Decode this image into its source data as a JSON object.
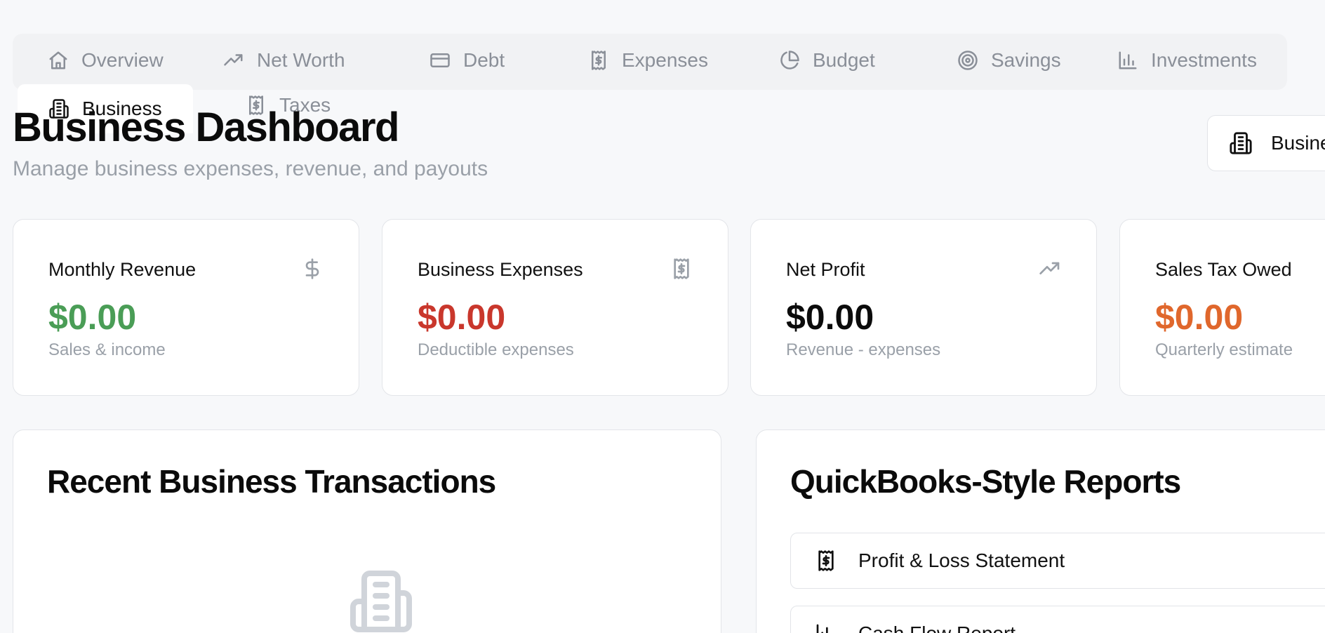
{
  "tabs": [
    {
      "label": "Overview",
      "icon": "home-icon"
    },
    {
      "label": "Net Worth",
      "icon": "trending-up-icon"
    },
    {
      "label": "Debt",
      "icon": "credit-card-icon"
    },
    {
      "label": "Expenses",
      "icon": "receipt-icon"
    },
    {
      "label": "Budget",
      "icon": "pie-chart-icon"
    },
    {
      "label": "Savings",
      "icon": "target-icon"
    },
    {
      "label": "Investments",
      "icon": "bar-chart-icon"
    },
    {
      "label": "Business",
      "icon": "building-icon",
      "active": true
    },
    {
      "label": "Taxes",
      "icon": "receipt-icon"
    }
  ],
  "header": {
    "title": "Business Dashboard",
    "subtitle": "Manage business expenses, revenue, and payouts",
    "action_label": "Business"
  },
  "stats": [
    {
      "label": "Monthly Revenue",
      "value": "$0.00",
      "sub": "Sales & income",
      "icon": "dollar-icon",
      "color": "#4a9d56"
    },
    {
      "label": "Business Expenses",
      "value": "$0.00",
      "sub": "Deductible expenses",
      "icon": "receipt-icon",
      "color": "#c9372c"
    },
    {
      "label": "Net Profit",
      "value": "$0.00",
      "sub": "Revenue - expenses",
      "icon": "trending-up-icon",
      "color": "#0b0b0b"
    },
    {
      "label": "Sales Tax Owed",
      "value": "$0.00",
      "sub": "Quarterly estimate",
      "icon": "calculator-icon",
      "color": "#e0672c"
    }
  ],
  "transactions_panel": {
    "title": "Recent Business Transactions"
  },
  "reports_panel": {
    "title": "QuickBooks-Style Reports",
    "reports": [
      {
        "label": "Profit & Loss Statement",
        "icon": "receipt-icon"
      },
      {
        "label": "Cash Flow Report",
        "icon": "bar-chart-icon"
      }
    ]
  }
}
